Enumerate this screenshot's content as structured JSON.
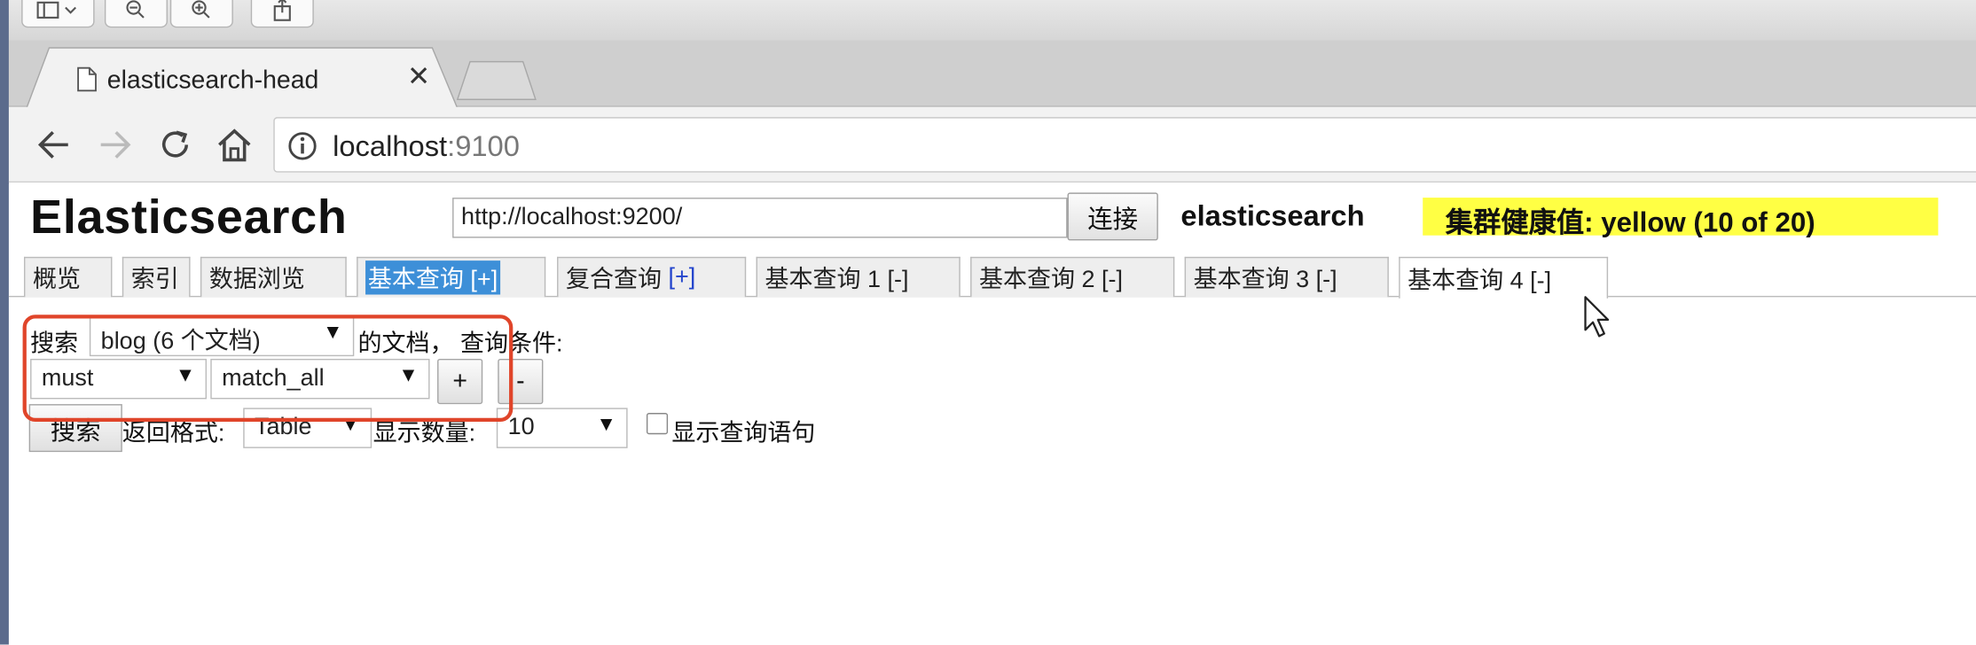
{
  "browser": {
    "tab_title": "elasticsearch-head",
    "tab_close": "✕",
    "url_host": "localhost",
    "url_port": ":9100"
  },
  "header": {
    "title": "Elasticsearch",
    "cluster_url": "http://localhost:9200/",
    "connect_label": "连接",
    "cluster_name": "elasticsearch",
    "health": "集群健康值: yellow (10 of 20)"
  },
  "tabs": [
    {
      "label": "概览"
    },
    {
      "label": "索引"
    },
    {
      "label": "数据浏览"
    },
    {
      "label": "基本查询",
      "suffix": "[+]"
    },
    {
      "label": "复合查询",
      "suffix": "[+]"
    },
    {
      "label": "基本查询 1 [-]"
    },
    {
      "label": "基本查询 2 [-]"
    },
    {
      "label": "基本查询 3 [-]"
    },
    {
      "label": "基本查询 4 [-]"
    }
  ],
  "query": {
    "search_prefix": "搜索",
    "index_select": "blog (6 个文档)",
    "docs_suffix": "的文档，  查询条件:",
    "bool_select": "must",
    "clause_select": "match_all",
    "add_label": "+",
    "remove_label": "-",
    "search_button": "搜索",
    "format_label": "返回格式:",
    "format_select": "Table",
    "size_label": "显示数量:",
    "size_select": "10",
    "show_query_label": "显示查询语句"
  },
  "icons": {
    "arrow": "▼",
    "back": "arrow-left-icon",
    "forward": "arrow-right-icon",
    "reload": "reload-icon",
    "home": "home-icon",
    "info": "info-icon",
    "sidebar": "sidebar-icon",
    "zoom_out": "zoom-out-icon",
    "zoom_in": "zoom-in-icon",
    "share": "share-icon"
  },
  "colors": {
    "health_yellow": "#ffff44",
    "highlight_blue": "#3d8fd8",
    "annotation_red": "#e0452a"
  }
}
